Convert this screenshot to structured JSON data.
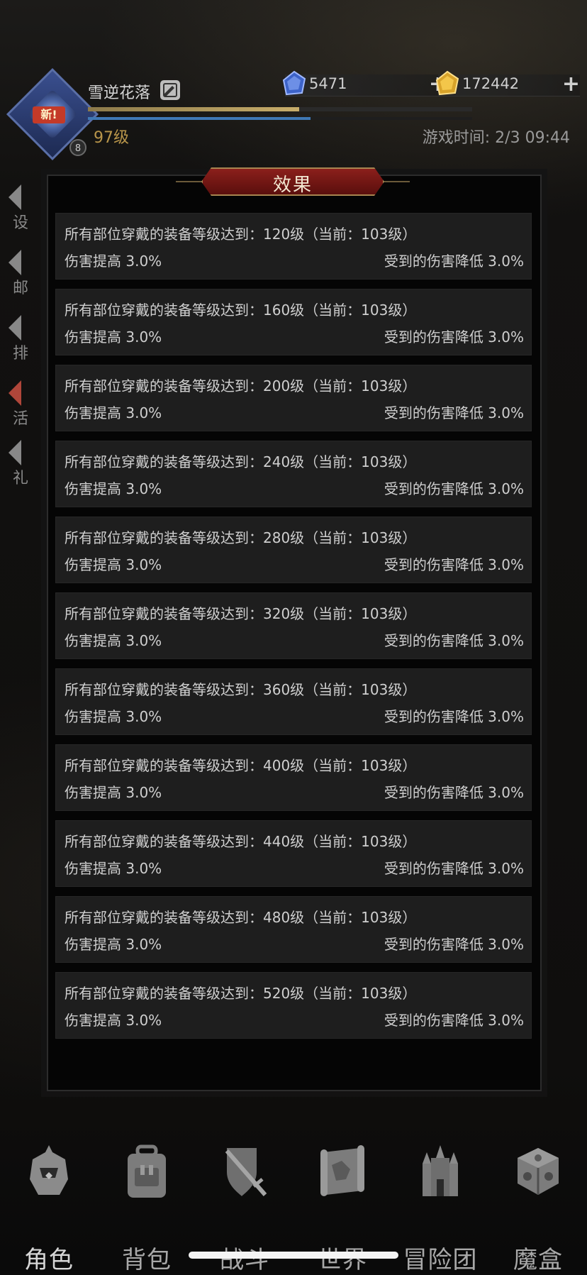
{
  "header": {
    "player_name": "雪逆花落",
    "new_badge": "新!",
    "vip_level": "8",
    "level": "97级",
    "game_time": "游戏时间: 2/3 09:44",
    "exp_progress": 0.55,
    "mp_progress": 0.58
  },
  "currencies": [
    {
      "name": "blue-gem",
      "value": "5471",
      "plus": "+",
      "color": "#3d63c9"
    },
    {
      "name": "gold-gem",
      "value": "172442",
      "plus": "+",
      "color": "#d8a32a"
    }
  ],
  "side_menu": [
    {
      "label": "设"
    },
    {
      "label": "邮"
    },
    {
      "label": "排"
    },
    {
      "label": "活"
    },
    {
      "label": "礼"
    }
  ],
  "modal": {
    "title": "效果",
    "rows": [
      {
        "condition": "所有部位穿戴的装备等级达到：120级（当前：103级）",
        "left": "伤害提高 3.0%",
        "right": "受到的伤害降低 3.0%"
      },
      {
        "condition": "所有部位穿戴的装备等级达到：160级（当前：103级）",
        "left": "伤害提高 3.0%",
        "right": "受到的伤害降低 3.0%"
      },
      {
        "condition": "所有部位穿戴的装备等级达到：200级（当前：103级）",
        "left": "伤害提高 3.0%",
        "right": "受到的伤害降低 3.0%"
      },
      {
        "condition": "所有部位穿戴的装备等级达到：240级（当前：103级）",
        "left": "伤害提高 3.0%",
        "right": "受到的伤害降低 3.0%"
      },
      {
        "condition": "所有部位穿戴的装备等级达到：280级（当前：103级）",
        "left": "伤害提高 3.0%",
        "right": "受到的伤害降低 3.0%"
      },
      {
        "condition": "所有部位穿戴的装备等级达到：320级（当前：103级）",
        "left": "伤害提高 3.0%",
        "right": "受到的伤害降低 3.0%"
      },
      {
        "condition": "所有部位穿戴的装备等级达到：360级（当前：103级）",
        "left": "伤害提高 3.0%",
        "right": "受到的伤害降低 3.0%"
      },
      {
        "condition": "所有部位穿戴的装备等级达到：400级（当前：103级）",
        "left": "伤害提高 3.0%",
        "right": "受到的伤害降低 3.0%"
      },
      {
        "condition": "所有部位穿戴的装备等级达到：440级（当前：103级）",
        "left": "伤害提高 3.0%",
        "right": "受到的伤害降低 3.0%"
      },
      {
        "condition": "所有部位穿戴的装备等级达到：480级（当前：103级）",
        "left": "伤害提高 3.0%",
        "right": "受到的伤害降低 3.0%"
      },
      {
        "condition": "所有部位穿戴的装备等级达到：520级（当前：103级）",
        "left": "伤害提高 3.0%",
        "right": "受到的伤害降低 3.0%"
      }
    ]
  },
  "bottom_nav": [
    {
      "label": "角色",
      "icon": "helmet-icon",
      "active": true
    },
    {
      "label": "背包",
      "icon": "backpack-icon",
      "active": false
    },
    {
      "label": "战斗",
      "icon": "sword-shield-icon",
      "active": false
    },
    {
      "label": "世界",
      "icon": "map-scroll-icon",
      "active": false
    },
    {
      "label": "冒险团",
      "icon": "castle-icon",
      "active": false
    },
    {
      "label": "魔盒",
      "icon": "magic-cube-icon",
      "active": false
    }
  ]
}
